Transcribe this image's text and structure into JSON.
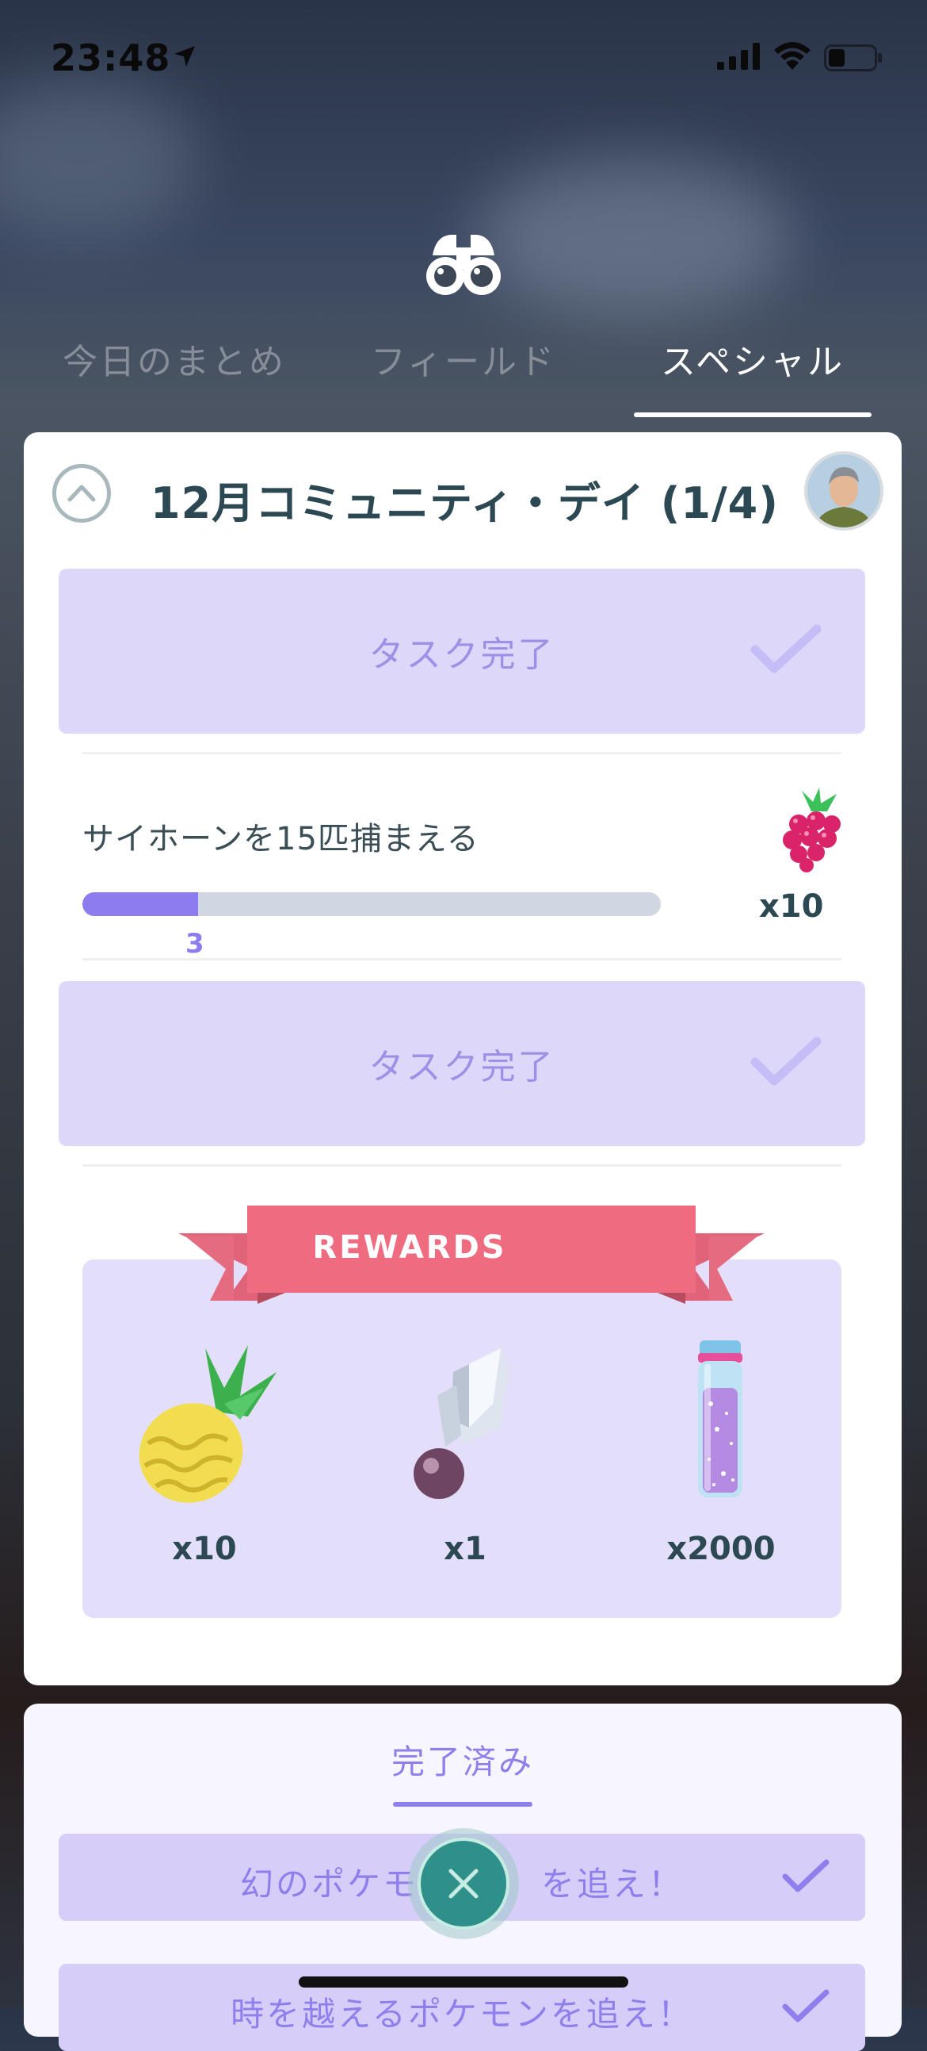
{
  "status_bar": {
    "time": "23:48"
  },
  "tabs": [
    {
      "label": "今日のまとめ"
    },
    {
      "label": "フィールド"
    },
    {
      "label": "スペシャル",
      "active": true
    }
  ],
  "research": {
    "title": "12月コミュニティ・デイ (1/4)",
    "task_completed_label": "タスク完了",
    "active_task": {
      "text": "サイホーンを15匹捕まえる",
      "progress_value": "3",
      "progress_fraction": 0.2,
      "reward_qty": "x10",
      "reward_icon": "razz-berry-icon"
    },
    "rewards_banner": "REWARDS",
    "rewards": [
      {
        "icon": "golden-pinap-berry-icon",
        "qty": "x10"
      },
      {
        "icon": "sinnoh-stone-icon",
        "qty": "x1"
      },
      {
        "icon": "stardust-icon",
        "qty": "x2000"
      }
    ]
  },
  "completed": {
    "tab_label": "完了済み",
    "items": [
      {
        "label": "幻のポケモン"
      },
      {
        "label": "を追え！"
      },
      {
        "label": "時を越えるポケモンを追え！"
      }
    ]
  },
  "colors": {
    "accent": "#8c7cf0",
    "task_bg": "#ddd7f9",
    "ribbon": "#ee6b80",
    "close": "#2f8f8a"
  }
}
